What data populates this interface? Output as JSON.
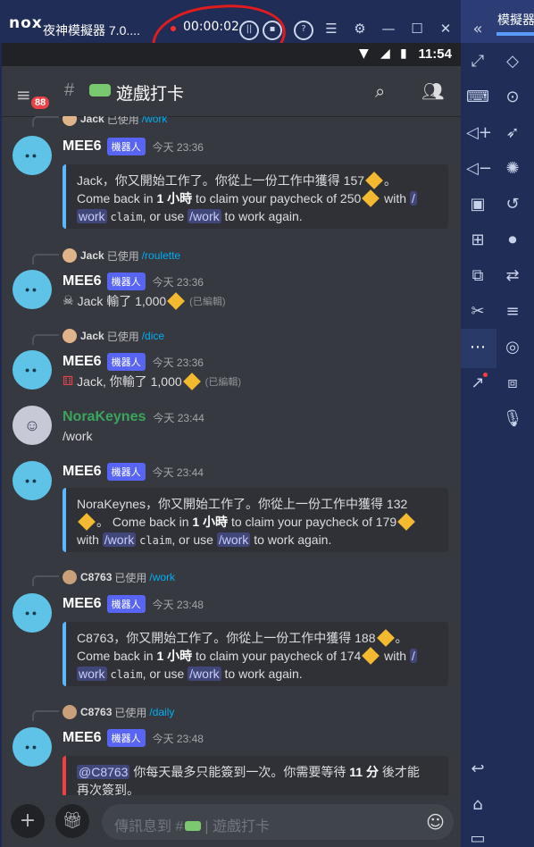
{
  "window": {
    "logo": "nox",
    "title": "夜神模擬器 7.0....",
    "record_time": "00:00:02",
    "right_partial_title": "模擬器設"
  },
  "android": {
    "clock": "11:54"
  },
  "channel": {
    "name": "遊戲打卡",
    "unread_badge": "88"
  },
  "messages": [
    {
      "reply": {
        "user": "Jack",
        "verb": "已使用",
        "command": "/work"
      },
      "author": "MEE6",
      "bot_tag": "機器人",
      "time": "今天 23:36",
      "embed": {
        "line1_pre": "Jack，你又開始工作了。你從上一份工作中獲得 157",
        "line1_post": "。",
        "line2_a": "Come back in ",
        "line2_bold": "1 小時",
        "line2_b": " to claim your paycheck of 250",
        "line2_c": " with ",
        "cmd1": "/",
        "cmd1b": "work",
        "arg": "claim",
        "line3_mid": ", or use ",
        "cmd2": "/work",
        "line3_end": " to work again."
      }
    },
    {
      "reply": {
        "user": "Jack",
        "verb": "已使用",
        "command": "/roulette"
      },
      "author": "MEE6",
      "bot_tag": "機器人",
      "time": "今天 23:36",
      "text": "Jack 輸了 1,000",
      "edited": "(已編輯)"
    },
    {
      "reply": {
        "user": "Jack",
        "verb": "已使用",
        "command": "/dice"
      },
      "author": "MEE6",
      "bot_tag": "機器人",
      "time": "今天 23:36",
      "text": "Jack, 你輸了 1,000",
      "edited": "(已編輯)"
    },
    {
      "author": "NoraKeynes",
      "time": "今天 23:44",
      "text": "/work"
    },
    {
      "author": "MEE6",
      "bot_tag": "機器人",
      "time": "今天 23:44",
      "embed": {
        "line1_pre": "NoraKeynes，你又開始工作了。你從上一份工作中獲得 132",
        "line2_a": "。 Come back in ",
        "line2_bold": "1 小時",
        "line2_b": " to claim your paycheck of 179",
        "line3_a": "with ",
        "cmd1": "/work",
        "arg": "claim",
        "line3_mid": ", or use ",
        "cmd2": "/work",
        "line3_end": " to work again."
      }
    },
    {
      "reply": {
        "user": "C8763",
        "verb": "已使用",
        "command": "/work"
      },
      "author": "MEE6",
      "bot_tag": "機器人",
      "time": "今天 23:48",
      "embed": {
        "line1_pre": "C8763，你又開始工作了。你從上一份工作中獲得 188",
        "line1_post": "。",
        "line2_a": "Come back in ",
        "line2_bold": "1 小時",
        "line2_b": " to claim your paycheck of 174",
        "line2_c": " with ",
        "cmd1": "/",
        "cmd1b": "work",
        "arg": "claim",
        "line3_mid": ", or use ",
        "cmd2": "/work",
        "line3_end": " to work again."
      }
    },
    {
      "reply": {
        "user": "C8763",
        "verb": "已使用",
        "command": "/daily"
      },
      "author": "MEE6",
      "bot_tag": "機器人",
      "time": "今天 23:48",
      "embed": {
        "mention": "@C8763",
        "line1": " 你每天最多只能簽到一次。你需要等待 ",
        "bold": "11 分",
        "line1_end": " 後才能",
        "line2": "再次簽到。"
      }
    }
  ],
  "input": {
    "placeholder_a": "傳訊息到 #",
    "placeholder_b": "遊戲打卡"
  },
  "colors": {
    "accent": "#5865f2",
    "embed_border": "#58b9ff",
    "embed_border_error": "#ed4245",
    "coin": "#f3ba2f",
    "name_green": "#3ba55d",
    "link": "#00aff4"
  }
}
